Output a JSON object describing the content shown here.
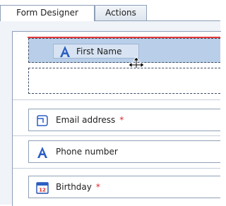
{
  "tabs": [
    {
      "label": "Form Designer",
      "active": true
    },
    {
      "label": "Actions",
      "active": false
    }
  ],
  "dragging": {
    "label": "First Name",
    "icon": "text-field-icon"
  },
  "fields": [
    {
      "label": "Email address",
      "required_mark": "*",
      "icon": "email-field-icon"
    },
    {
      "label": "Phone number",
      "required_mark": "",
      "icon": "text-field-icon"
    },
    {
      "label": "Birthday",
      "required_mark": "*",
      "icon": "calendar-icon",
      "calendar_day": "12"
    }
  ],
  "colors": {
    "accent_blue": "#2b5ec4",
    "required_red": "#e22323",
    "insertion_line": "#e23a3a",
    "drag_highlight": "#b9cfe9"
  }
}
